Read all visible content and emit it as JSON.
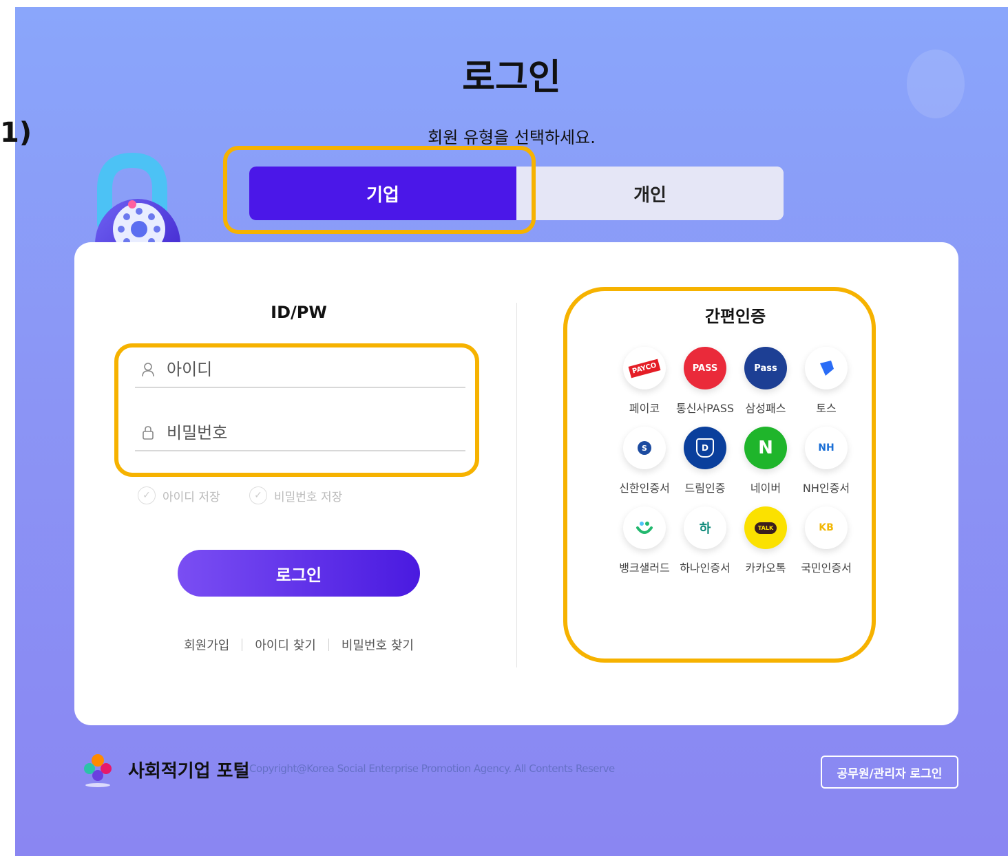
{
  "side_label": "1)",
  "page_title": "로그인",
  "subtitle": "회원 유형을 선택하세요.",
  "member_tabs": [
    {
      "label": "기업",
      "active": true
    },
    {
      "label": "개인",
      "active": false
    }
  ],
  "idpw": {
    "title": "ID/PW",
    "id_placeholder": "아이디",
    "pw_placeholder": "비밀번호",
    "save_id_label": "아이디 저장",
    "save_pw_label": "비밀번호 저장",
    "login_label": "로그인",
    "links": [
      "회원가입",
      "아이디 찾기",
      "비밀번호 찾기"
    ]
  },
  "easy_auth": {
    "title": "간편인증",
    "providers": [
      {
        "name": "페이코",
        "icon": "payco-icon",
        "badge": "PAYCO",
        "color": "#e41e26"
      },
      {
        "name": "통신사PASS",
        "icon": "pass-icon",
        "badge": "PASS",
        "color": "#ea2a3a"
      },
      {
        "name": "삼성패스",
        "icon": "samsung-pass-icon",
        "badge": "Pass",
        "color": "#1d3f94"
      },
      {
        "name": "토스",
        "icon": "toss-icon",
        "badge": "",
        "color": "#2a6cf6"
      },
      {
        "name": "신한인증서",
        "icon": "shinhan-icon",
        "badge": "S",
        "color": "#1c4ba0"
      },
      {
        "name": "드림인증",
        "icon": "dream-icon",
        "badge": "D",
        "color": "#0a3f9c"
      },
      {
        "name": "네이버",
        "icon": "naver-icon",
        "badge": "N",
        "color": "#1fb52b"
      },
      {
        "name": "NH인증서",
        "icon": "nh-icon",
        "badge": "NH",
        "color": "#1b6fd6"
      },
      {
        "name": "뱅크샐러드",
        "icon": "banksalad-icon",
        "badge": "",
        "color": "#22b86e"
      },
      {
        "name": "하나인증서",
        "icon": "hana-icon",
        "badge": "하",
        "color": "#0e8a7a"
      },
      {
        "name": "카카오톡",
        "icon": "kakao-icon",
        "badge": "TALK",
        "color": "#fbe100"
      },
      {
        "name": "국민인증서",
        "icon": "kb-icon",
        "badge": "KB",
        "color": "#f2b705"
      }
    ]
  },
  "footer": {
    "portal_name": "사회적기업 포털",
    "copyright": "Copyright@Korea Social Enterprise Promotion Agency. All Contents Reserve",
    "admin_login": "공무원/관리자 로그인"
  },
  "colors": {
    "accent": "#4b17e8",
    "highlight": "#f6b200",
    "background": "#8a9cf8"
  }
}
